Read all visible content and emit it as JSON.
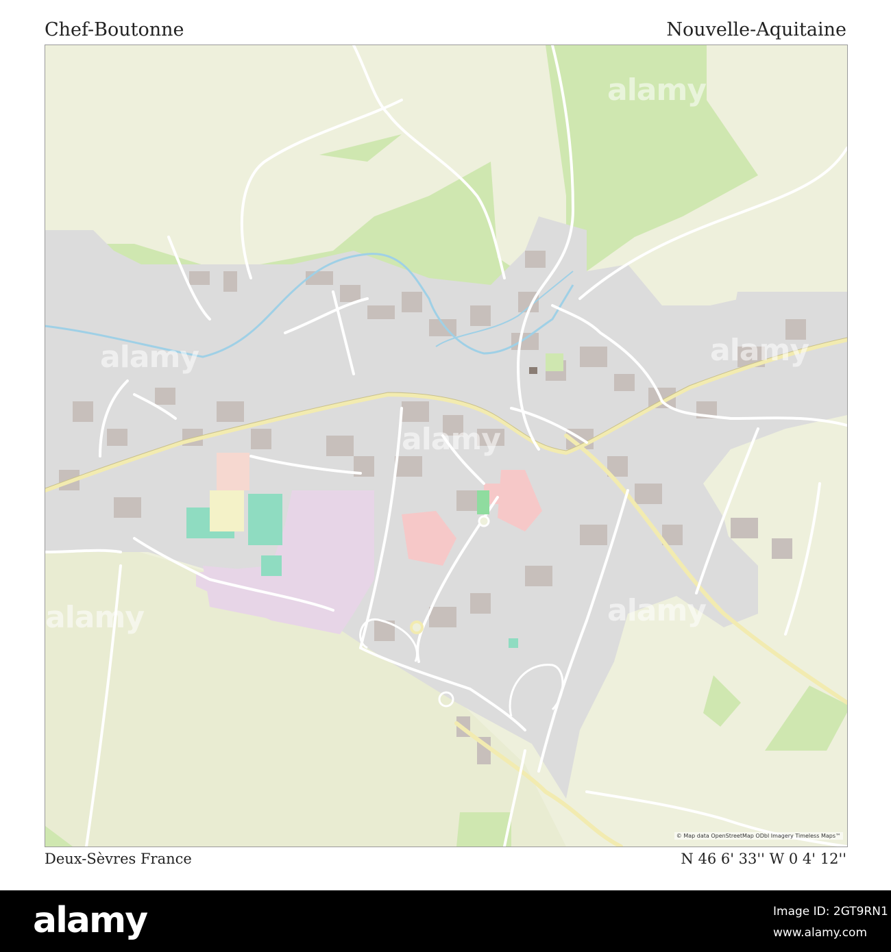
{
  "header": {
    "city": "Chef-Boutonne",
    "region": "Nouvelle-Aquitaine"
  },
  "footer": {
    "department_country": "Deux-Sèvres  France",
    "coordinates": "N 46 6' 33''   W 0 4' 12''"
  },
  "map": {
    "attribution": "© Map data OpenStreetMap ODbl Imagery Timeless Maps™",
    "watermark": "alamy",
    "colors": {
      "farmland": "#eef0dc",
      "forest": "#cfe7b0",
      "forest_dark": "#b9d99c",
      "orchard": "#88b48a",
      "urban": "#dcdcdc",
      "buildings": "#c7bfbb",
      "industrial": "#e7d5e7",
      "sports": "#8fdcc1",
      "water": "#9fd0e6",
      "main_road": "#f2ebb0",
      "road": "#ffffff",
      "red_zone": "#f6c8c8"
    }
  },
  "bottom_bar": {
    "logo": "alamy",
    "image_id": "Image ID: 2GT9RN1",
    "url": "www.alamy.com"
  }
}
